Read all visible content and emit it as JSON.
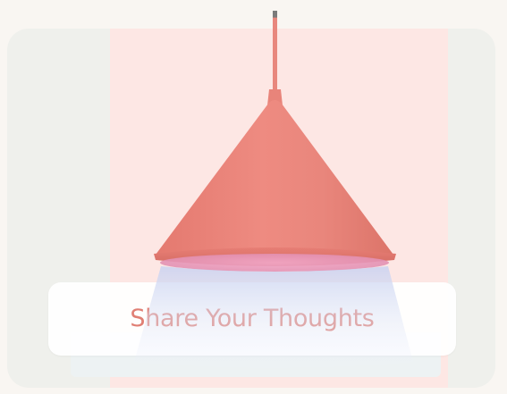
{
  "cta": {
    "label": "Share Your Thoughts"
  },
  "illustration": {
    "icon": "pendant-lamp-icon",
    "lamp_color": "#e9887d",
    "light_color": "#d9dff6"
  },
  "colors": {
    "page_background": "#f9f6f2",
    "card_background": "#eff0ec",
    "accent_panel": "#fde7e4",
    "cta_text": "#e07f74"
  }
}
